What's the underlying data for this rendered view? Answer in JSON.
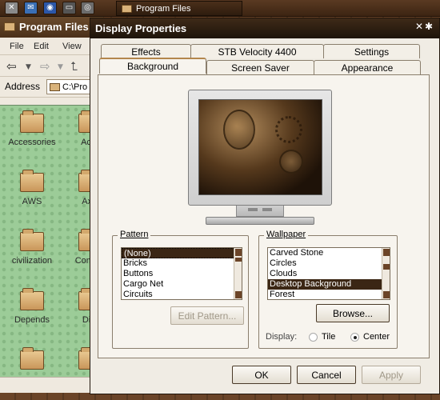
{
  "taskbar": {
    "task_label": "Program Files",
    "icons": [
      "close-app-icon",
      "mail-icon",
      "web-icon",
      "terminal-icon",
      "eye-icon"
    ]
  },
  "explorer": {
    "title": "Program Files",
    "menu": [
      "File",
      "Edit",
      "View"
    ],
    "address_label": "Address",
    "address_value": "C:\\Pro",
    "items": [
      "Accessories",
      "Activ",
      "AWS",
      "Axia",
      "civilization",
      "Commo",
      "Depends",
      "Dire"
    ]
  },
  "dialog": {
    "title": "Display Properties",
    "tabs_back": [
      "Effects",
      "STB Velocity 4400",
      "Settings"
    ],
    "tabs_front": [
      "Background",
      "Screen Saver",
      "Appearance"
    ],
    "active_tab": "Background",
    "pattern": {
      "label": "Pattern",
      "items": [
        "(None)",
        "Bricks",
        "Buttons",
        "Cargo Net",
        "Circuits"
      ],
      "selected": "(None)",
      "edit_button": "Edit Pattern..."
    },
    "wallpaper": {
      "label": "Wallpaper",
      "items": [
        "Carved Stone",
        "Circles",
        "Clouds",
        "Desktop Background",
        "Forest"
      ],
      "selected": "Desktop Background",
      "browse_button": "Browse...",
      "display_label": "Display:",
      "option_tile": "Tile",
      "option_center": "Center",
      "display_selected": "Center"
    },
    "buttons": {
      "ok": "OK",
      "cancel": "Cancel",
      "apply": "Apply"
    }
  },
  "colors": {
    "accent": "#3b2614",
    "title_bar": "#1e140a",
    "desktop_green": "#9ccc98"
  }
}
